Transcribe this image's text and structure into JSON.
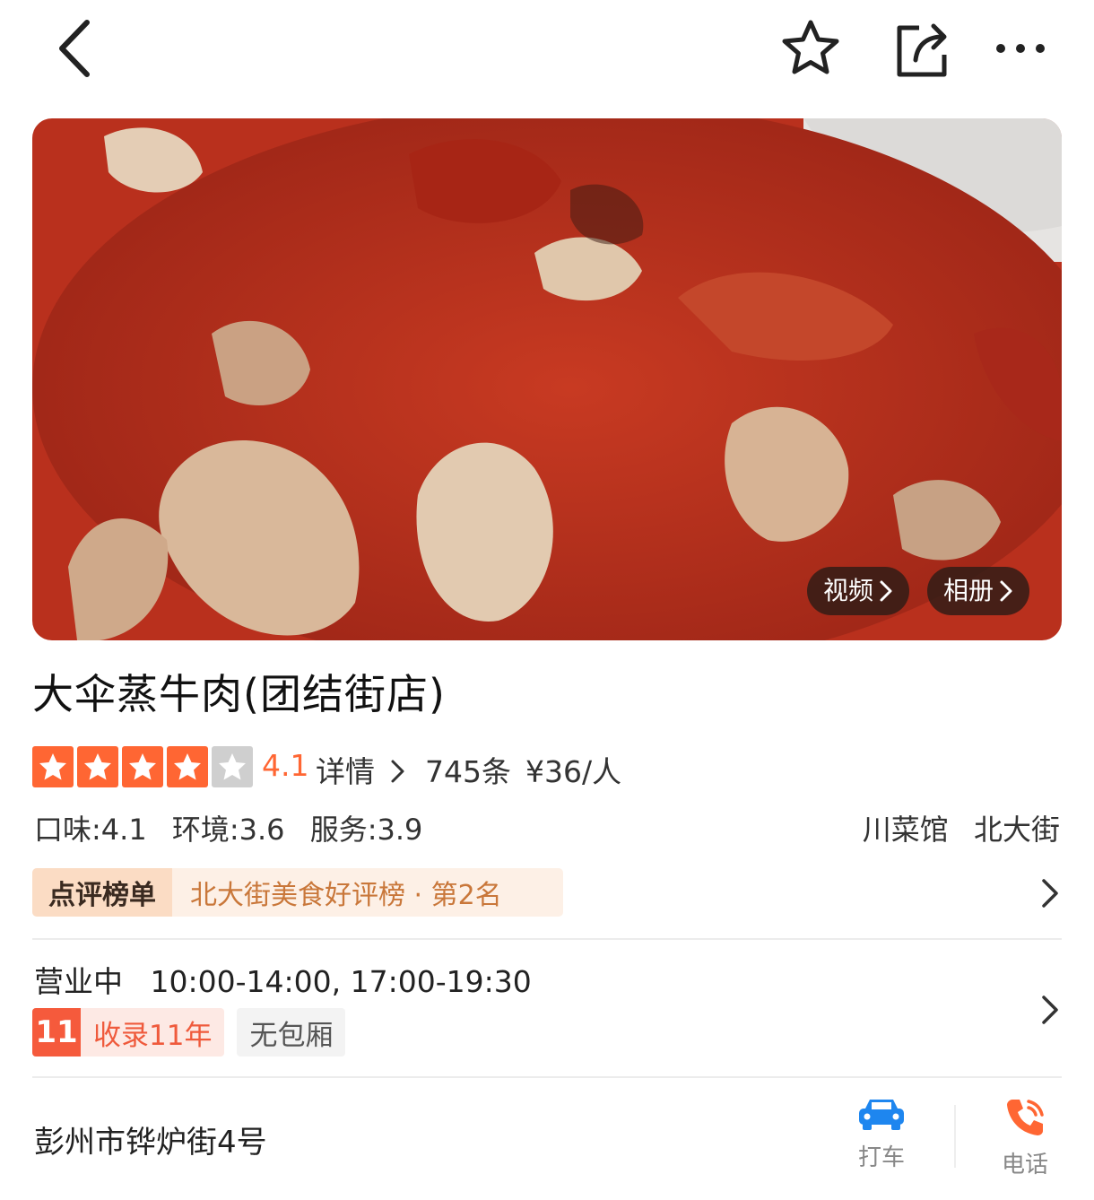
{
  "header": {
    "back_icon": "chevron-left-icon",
    "favorite_icon": "star-outline-icon",
    "share_icon": "share-icon",
    "more_icon": "more-dots-icon"
  },
  "hero": {
    "video_label": "视频",
    "album_label": "相册"
  },
  "shop": {
    "name": "大伞蒸牛肉(团结街店)",
    "rating": {
      "value": 4.1,
      "stars_filled": 4,
      "stars_total": 5,
      "score_text": "4.1"
    },
    "detail_label": "详情",
    "review_count": "745条",
    "price_per_person": "¥36/人",
    "subscores": [
      "口味:4.1",
      "环境:3.6",
      "服务:3.9"
    ],
    "category": "川菜馆",
    "district": "北大街",
    "ranking": {
      "badge": "点评榜单",
      "text": "北大街美食好评榜 · 第2名"
    },
    "business": {
      "status": "营业中",
      "hours": "10:00-14:00, 17:00-19:30"
    },
    "tags": {
      "years_number": "11",
      "years_text": "收录11年",
      "room": "无包厢"
    },
    "address": "彭州市铧炉街4号"
  },
  "actions": {
    "taxi_label": "打车",
    "call_label": "电话"
  },
  "colors": {
    "star_active": "#ff6633",
    "star_inactive": "#cfcfcf",
    "rating_text": "#ff6633",
    "rank_text": "#c9773a",
    "taxi_blue": "#1e86ef",
    "phone_orange": "#ff6633"
  }
}
